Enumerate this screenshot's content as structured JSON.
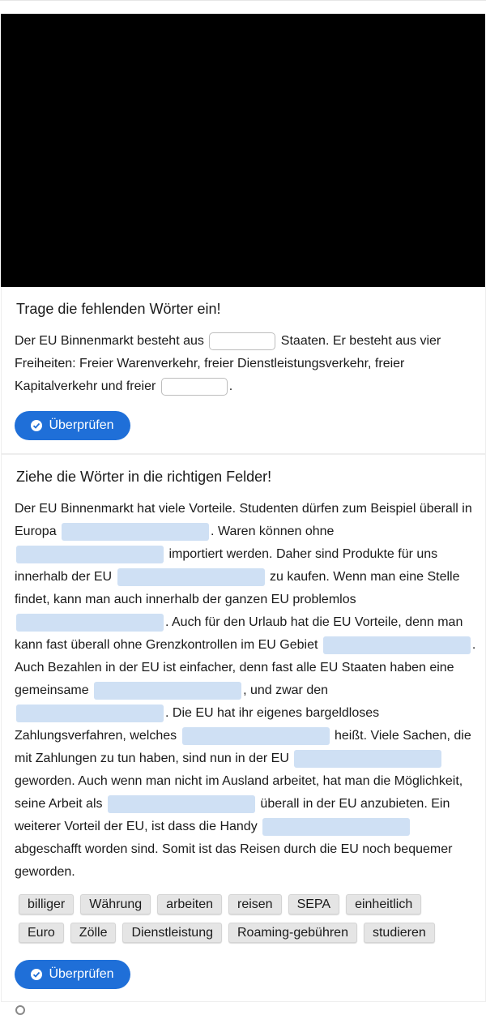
{
  "exercise1": {
    "title": "Trage die fehlenden Wörter ein!",
    "t1": "Der EU Binnenmarkt besteht aus",
    "t2": " Staaten. Er besteht aus vier Freiheiten: Freier Warenverkehr, freier Dienstleistungsverkehr, freier Kapitalverkehr und freier",
    "t3": ".",
    "check_label": "Überprüfen"
  },
  "exercise2": {
    "title": "Ziehe die Wörter in die richtigen Felder!",
    "segments": [
      "Der EU Binnenmarkt hat viele Vorteile. Studenten dürfen zum Beispiel überall in Europa",
      ". Waren können ohne",
      " importiert werden. Daher sind Produkte für uns innerhalb der EU",
      " zu kaufen. Wenn man eine Stelle findet, kann man auch innerhalb der ganzen EU problemlos",
      ". Auch für den Urlaub hat die EU Vorteile, denn man kann fast überall ohne Grenzkontrollen im EU Gebiet",
      ". Auch Bezahlen in der EU ist einfacher, denn fast alle EU Staaten haben eine gemeinsame",
      ", und zwar den",
      ". Die EU hat ihr eigenes bargeldloses Zahlungsverfahren, welches",
      " heißt. Viele Sachen, die mit Zahlungen zu tun haben, sind nun in der EU",
      " geworden. Auch wenn man nicht im Ausland arbeitet, hat man die Möglichkeit, seine Arbeit als",
      " überall in der EU anzubieten. Ein weiterer Vorteil der EU, ist dass die Handy",
      " abgeschafft worden sind. Somit ist das Reisen durch die EU noch bequemer geworden."
    ],
    "chips_row1": [
      "billiger",
      "Währung",
      "arbeiten",
      "reisen",
      "SEPA",
      "einheitlich"
    ],
    "chips_row2": [
      "Euro",
      "Zölle",
      "Dienstleistung",
      "Roaming-gebühren",
      "studieren"
    ],
    "check_label": "Überprüfen"
  },
  "colors": {
    "button": "#1f6fd8",
    "dropzone": "#cfe0f4",
    "chip": "#e5e5e5"
  }
}
